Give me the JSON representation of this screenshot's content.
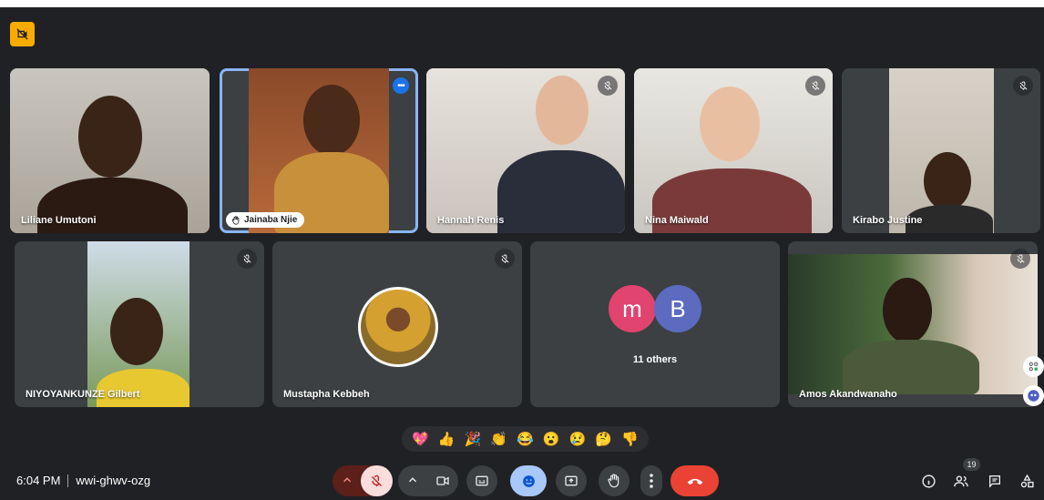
{
  "meeting": {
    "time": "6:04 PM",
    "code": "wwi-ghwv-ozg"
  },
  "participants": [
    {
      "name": "Liliane Umutoni"
    },
    {
      "name": "Jainaba Njie"
    },
    {
      "name": "Hannah Renis"
    },
    {
      "name": "Nina Maiwald"
    },
    {
      "name": "Kirabo Justine"
    },
    {
      "name": "NIYOYANKUNZE Gilbert"
    },
    {
      "name": "Mustapha Kebbeh"
    },
    {
      "name": "Amos Akandwanaho"
    }
  ],
  "others": {
    "label": "11 others",
    "avatars": [
      "m",
      "B"
    ]
  },
  "reactions": [
    "💖",
    "👍",
    "🎉",
    "👏",
    "😂",
    "😮",
    "😢",
    "🤔",
    "👎"
  ],
  "people_count": "19",
  "colors": {
    "accent": "#8ab4f8",
    "end_call": "#ea4335",
    "muted_bg": "#f9dedc",
    "camera_off_badge": "#f9ab00"
  }
}
